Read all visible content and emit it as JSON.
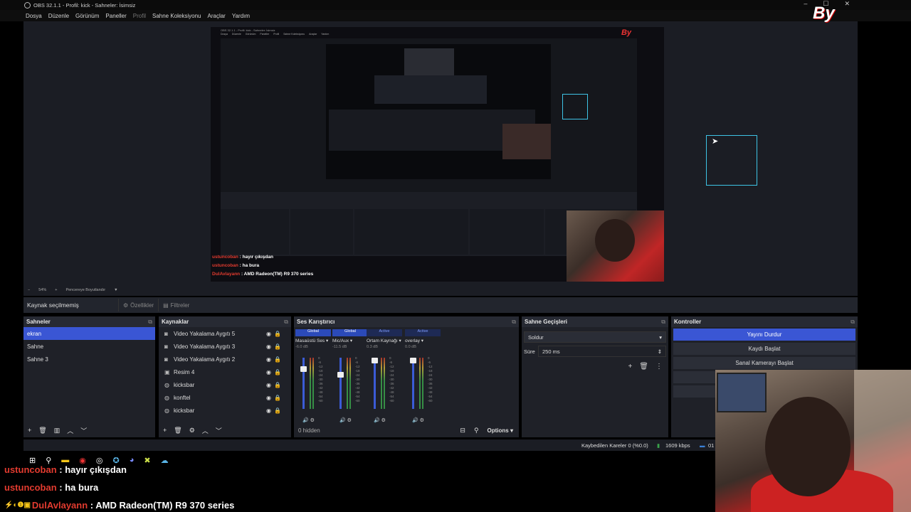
{
  "window": {
    "title": "OBS 32.1.1 - Profil: kick - Sahneler: İsimsiz",
    "controls": [
      "–",
      "☐",
      "✕"
    ]
  },
  "menu": [
    "Dosya",
    "Düzenle",
    "Görünüm",
    "Paneller",
    "Profil",
    "Sahne Koleksiyonu",
    "Araçlar",
    "Yardım"
  ],
  "preview_toolbar": {
    "zoom": "54%",
    "fit": "Pencereye Boyutlandır"
  },
  "source_bar": {
    "no_selection": "Kaynak seçilmemiş",
    "properties": "Özellikler",
    "filters": "Filtreler"
  },
  "scenes": {
    "title": "Sahneler",
    "items": [
      "ekran",
      "Sahne",
      "Sahne 3"
    ],
    "selected": 0
  },
  "sources": {
    "title": "Kaynaklar",
    "items": [
      {
        "label": "Video Yakalama Aygıtı 5",
        "icon": "camera-icon"
      },
      {
        "label": "Video Yakalama Aygıtı 3",
        "icon": "camera-icon"
      },
      {
        "label": "Video Yakalama Aygıtı 2",
        "icon": "camera-icon"
      },
      {
        "label": "Resim 4",
        "icon": "image-icon"
      },
      {
        "label": "kicksbar",
        "icon": "browser-icon"
      },
      {
        "label": "konftel",
        "icon": "browser-icon"
      },
      {
        "label": "kicksbar",
        "icon": "browser-icon"
      }
    ]
  },
  "mixer": {
    "title": "Ses Karıştırıcı",
    "channels": [
      {
        "tag": "Global",
        "name": "Masaüstü Ses",
        "db": "-6.0 dB",
        "level": 0.78
      },
      {
        "tag": "Global",
        "name": "Mic/Aux",
        "db": "-11.5 dB",
        "level": 0.68
      },
      {
        "tag": "Active",
        "name": "Ortam Kaynağı",
        "db": "0.3 dB",
        "level": 0.9
      },
      {
        "tag": "Active",
        "name": "overlay",
        "db": "0.0 dB",
        "level": 0.9
      }
    ],
    "scale": [
      "0",
      "-6",
      "-12",
      "-18",
      "-24",
      "-30",
      "-36",
      "-42",
      "-48",
      "-54",
      "-60"
    ],
    "hidden": "0 hidden",
    "options": "Options"
  },
  "transitions": {
    "title": "Sahne Geçişleri",
    "transition": "Soldur",
    "duration_label": "Süre",
    "duration": "250 ms"
  },
  "controls": {
    "title": "Kontroller",
    "buttons": [
      "Yayını Durdur",
      "Kaydı Başlat",
      "Sanal Kamerayı Başlat"
    ]
  },
  "status": {
    "dropped": "Kaybedilen Kareler 0 (%0.0)",
    "bitrate": "1609 kbps",
    "time": "01"
  },
  "chat": [
    {
      "user": "ustuncoban",
      "text": " : hayır çıkışdan",
      "color": "#e23b2f"
    },
    {
      "user": "ustuncoban",
      "text": " : ha bura",
      "color": "#e23b2f"
    },
    {
      "user": "DulAvlayann",
      "text": " : AMD Radeon(TM) R9 370 series",
      "color": "#e23b2f"
    }
  ],
  "logo": "By",
  "colors": {
    "accent": "#3a56d4",
    "panel": "#1f2128",
    "chat_user": "#e23b2f",
    "selection_box": "#3ec4e6"
  }
}
